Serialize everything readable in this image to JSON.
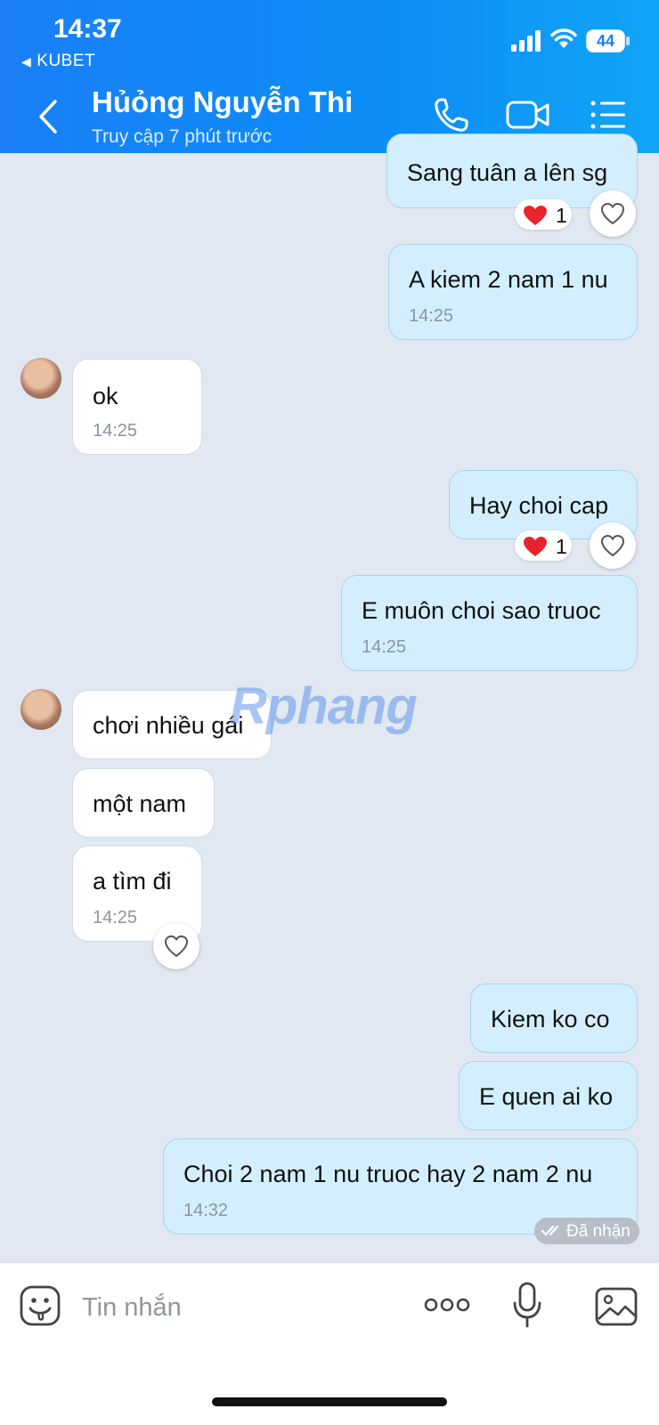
{
  "status_bar": {
    "time": "14:37",
    "back_app": "KUBET",
    "battery": "44"
  },
  "header": {
    "contact_name": "Hủỏng Nguyễn Thi",
    "status": "Truy cập 7 phút trước"
  },
  "messages": [
    {
      "sender": "me",
      "text": "Sang tuân a lên sg",
      "reaction": {
        "emoji": "heart",
        "count": "1"
      }
    },
    {
      "sender": "me",
      "text": "A kiem 2 nam 1 nu",
      "time": "14:25"
    },
    {
      "sender": "them",
      "text": "ok",
      "time": "14:25"
    },
    {
      "sender": "me",
      "text": "Hay choi cap",
      "reaction": {
        "emoji": "heart",
        "count": "1"
      }
    },
    {
      "sender": "me",
      "text": "E muôn choi sao truoc",
      "time": "14:25"
    },
    {
      "sender": "them",
      "text": "chơi nhiều gái"
    },
    {
      "sender": "them",
      "text": "một nam"
    },
    {
      "sender": "them",
      "text": "a tìm đi",
      "time": "14:25"
    },
    {
      "sender": "me",
      "text": "Kiem ko co"
    },
    {
      "sender": "me",
      "text": "E quen ai ko"
    },
    {
      "sender": "me",
      "text": "Choi 2 nam 1 nu truoc hay 2 nam 2 nu",
      "time": "14:32"
    }
  ],
  "delivery_status": "Đã nhận",
  "watermark": "Rphang",
  "input": {
    "placeholder": "Tin nhắn"
  },
  "icons": [
    "back-chevron-icon",
    "phone-icon",
    "video-call-icon",
    "list-menu-icon",
    "heart-icon",
    "emoji-icon",
    "more-icon",
    "microphone-icon",
    "photo-icon"
  ],
  "colors": {
    "header": "#1a7ff7",
    "my_bubble": "#d3efff",
    "their_bubble": "#ffffff",
    "background": "#e2e8f1",
    "heart": "#e8232e"
  }
}
